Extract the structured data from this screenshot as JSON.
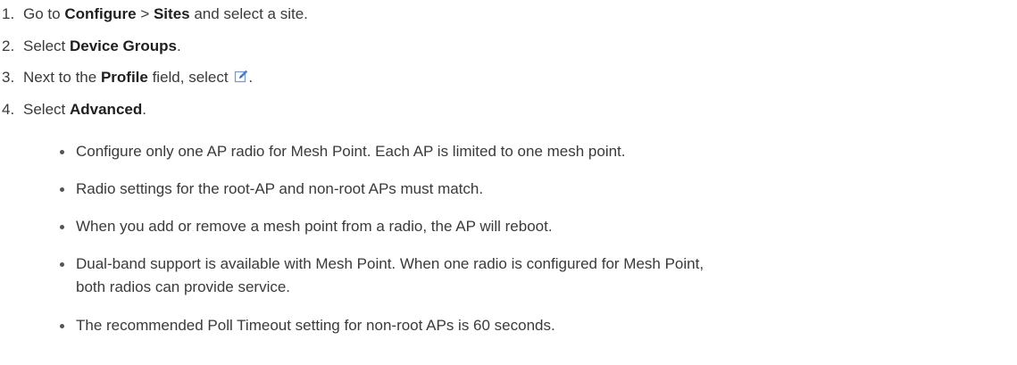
{
  "steps": [
    {
      "number": "1.",
      "pre": "Go to ",
      "b1": "Configure",
      "mid": " > ",
      "b2": "Sites",
      "post": " and select a site."
    },
    {
      "number": "2.",
      "pre": "Select ",
      "b1": "Device Groups",
      "post": "."
    },
    {
      "number": "3.",
      "pre": "Next to the ",
      "b1": "Profile",
      "mid": " field, select ",
      "post": ".",
      "icon": "edit-icon"
    },
    {
      "number": "4.",
      "pre": "Select ",
      "b1": "Advanced",
      "post": "."
    }
  ],
  "bullets": [
    {
      "lines": [
        "Configure only one AP radio for Mesh Point. Each AP is limited to one mesh point."
      ]
    },
    {
      "lines": [
        "Radio settings for the root-AP and non-root APs must match."
      ]
    },
    {
      "lines": [
        "When you add or remove a mesh point from a radio, the AP will reboot."
      ]
    },
    {
      "lines": [
        "Dual-band support is available with Mesh Point. When one radio is configured for Mesh Point,",
        "both radios can provide service."
      ]
    },
    {
      "lines": [
        "The recommended Poll Timeout setting for non-root APs is 60 seconds."
      ]
    }
  ]
}
